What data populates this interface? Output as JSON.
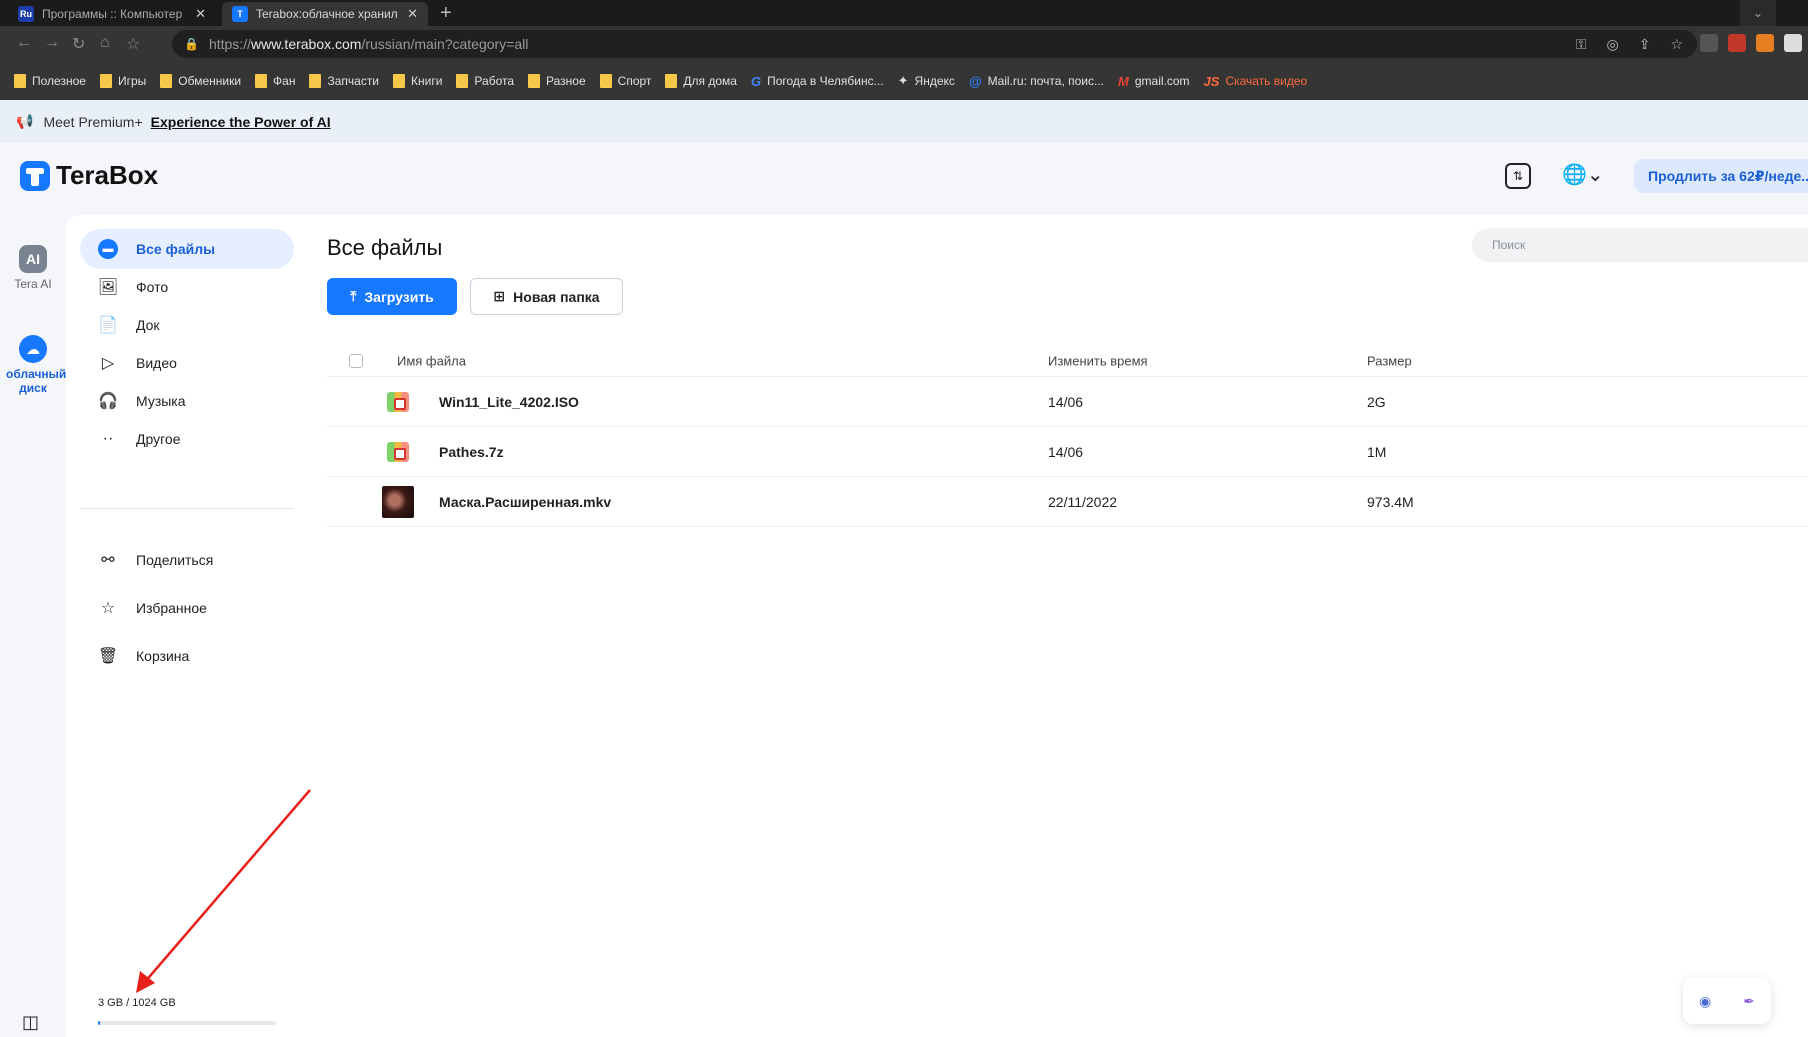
{
  "browser": {
    "tabs": [
      {
        "label": "Программы :: Компьютер",
        "favicon": "Ru"
      },
      {
        "label": "Terabox:облачное хранил",
        "favicon": "terabox-icon"
      }
    ],
    "url_prefix": "https://",
    "url_host": "www.terabox.com",
    "url_path": "/russian/main?category=all",
    "bookmarks": [
      "Полезное",
      "Игры",
      "Обменники",
      "Фан",
      "Запчасти",
      "Книги",
      "Работа",
      "Разное",
      "Спорт",
      "Для дома"
    ],
    "bookmark_links": [
      "Погода в Челябинс...",
      "Яндекс",
      "Mail.ru: почта, поис...",
      "gmail.com",
      "Скачать видео"
    ]
  },
  "banner": {
    "prefix": "Meet Premium+",
    "link": "Experience the Power of AI"
  },
  "header": {
    "logo": "TeraBox",
    "premium_button": "Продлить за 62₽/неде..."
  },
  "rail": {
    "ai_badge": "AI",
    "ai_label": "Tera AI",
    "cloud_label": "облачный диск"
  },
  "sidebar": {
    "items": [
      {
        "label": "Все файлы",
        "icon": "all-files-icon"
      },
      {
        "label": "Фото",
        "icon": "photo-icon"
      },
      {
        "label": "Док",
        "icon": "doc-icon"
      },
      {
        "label": "Видео",
        "icon": "video-icon"
      },
      {
        "label": "Музыка",
        "icon": "headphones-icon"
      },
      {
        "label": "Другое",
        "icon": "more-icon"
      }
    ],
    "secondary": [
      {
        "label": "Поделиться",
        "icon": "share-icon"
      },
      {
        "label": "Избранное",
        "icon": "star-icon"
      },
      {
        "label": "Корзина",
        "icon": "trash-icon"
      }
    ],
    "storage_text": "3 GB / 1024 GB",
    "storage_used_fraction": 0.003
  },
  "main": {
    "title": "Все файлы",
    "search_placeholder": "Поиск",
    "upload_button": "Загрузить",
    "new_folder_button": "Новая папка",
    "columns": {
      "name": "Имя файла",
      "time": "Изменить время",
      "size": "Размер"
    },
    "files": [
      {
        "name": "Win11_Lite_4202.ISO",
        "time": "14/06",
        "size": "2G",
        "type": "archive"
      },
      {
        "name": "Pathes.7z",
        "time": "14/06",
        "size": "1M",
        "type": "archive"
      },
      {
        "name": "Маска.Расширенная.mkv",
        "time": "22/11/2022",
        "size": "973.4M",
        "type": "video"
      }
    ]
  },
  "colors": {
    "accent": "#1677ff",
    "annotation_arrow": "#e8201c"
  }
}
